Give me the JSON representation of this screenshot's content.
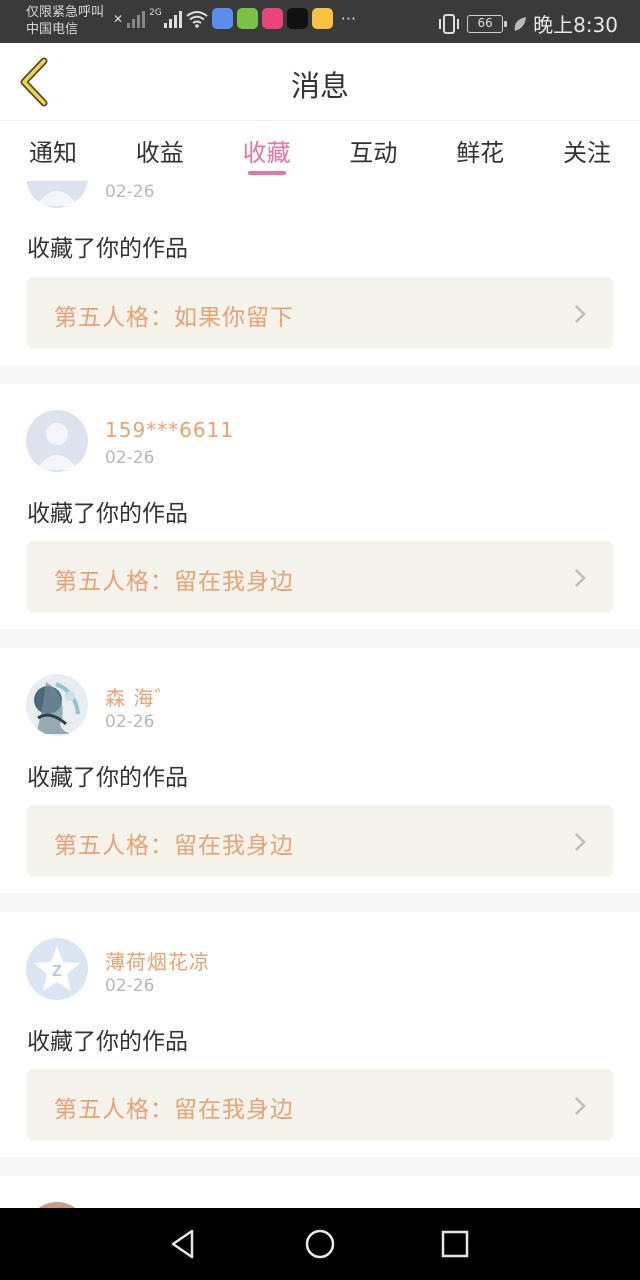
{
  "status_bar": {
    "carrier_line1": "仅限紧急呼叫",
    "carrier_line2": "中国电信",
    "network_label": "2G",
    "more": "···",
    "battery": "66",
    "time": "晚上8:30",
    "app_icons": [
      {
        "name": "music-app-icon",
        "color": "#5b8def"
      },
      {
        "name": "video-app-icon",
        "color": "#7cc242"
      },
      {
        "name": "meitu-app-icon",
        "color": "#e8467a"
      },
      {
        "name": "tiktok-app-icon",
        "color": "#111111"
      },
      {
        "name": "weibo-app-icon",
        "color": "#f6c343"
      }
    ]
  },
  "header": {
    "title": "消息"
  },
  "tabs": [
    {
      "label": "通知",
      "active": false
    },
    {
      "label": "收益",
      "active": false
    },
    {
      "label": "收藏",
      "active": true
    },
    {
      "label": "互动",
      "active": false
    },
    {
      "label": "鲜花",
      "active": false
    },
    {
      "label": "关注",
      "active": false
    }
  ],
  "colors": {
    "accent": "#e774a4",
    "username": "#e8a273",
    "work_bg": "#f4f3ec"
  },
  "feed": [
    {
      "username": "",
      "date": "02-26",
      "action": "收藏了你的作品",
      "work_title": "第五人格：如果你留下",
      "avatar": "default-avatar"
    },
    {
      "username": "159***6611",
      "date": "02-26",
      "action": "收藏了你的作品",
      "work_title": "第五人格：留在我身边",
      "avatar": "default-avatar"
    },
    {
      "username": "森 海゛",
      "date": "02-26",
      "action": "收藏了你的作品",
      "work_title": "第五人格：留在我身边",
      "avatar": "artwork-avatar"
    },
    {
      "username": "薄荷烟花凉",
      "date": "02-26",
      "action": "收藏了你的作品",
      "work_title": "第五人格：留在我身边",
      "avatar": "qzone-star-avatar"
    }
  ],
  "nav_bar": {
    "buttons": [
      "back-triangle-icon",
      "home-circle-icon",
      "recents-square-icon"
    ]
  }
}
